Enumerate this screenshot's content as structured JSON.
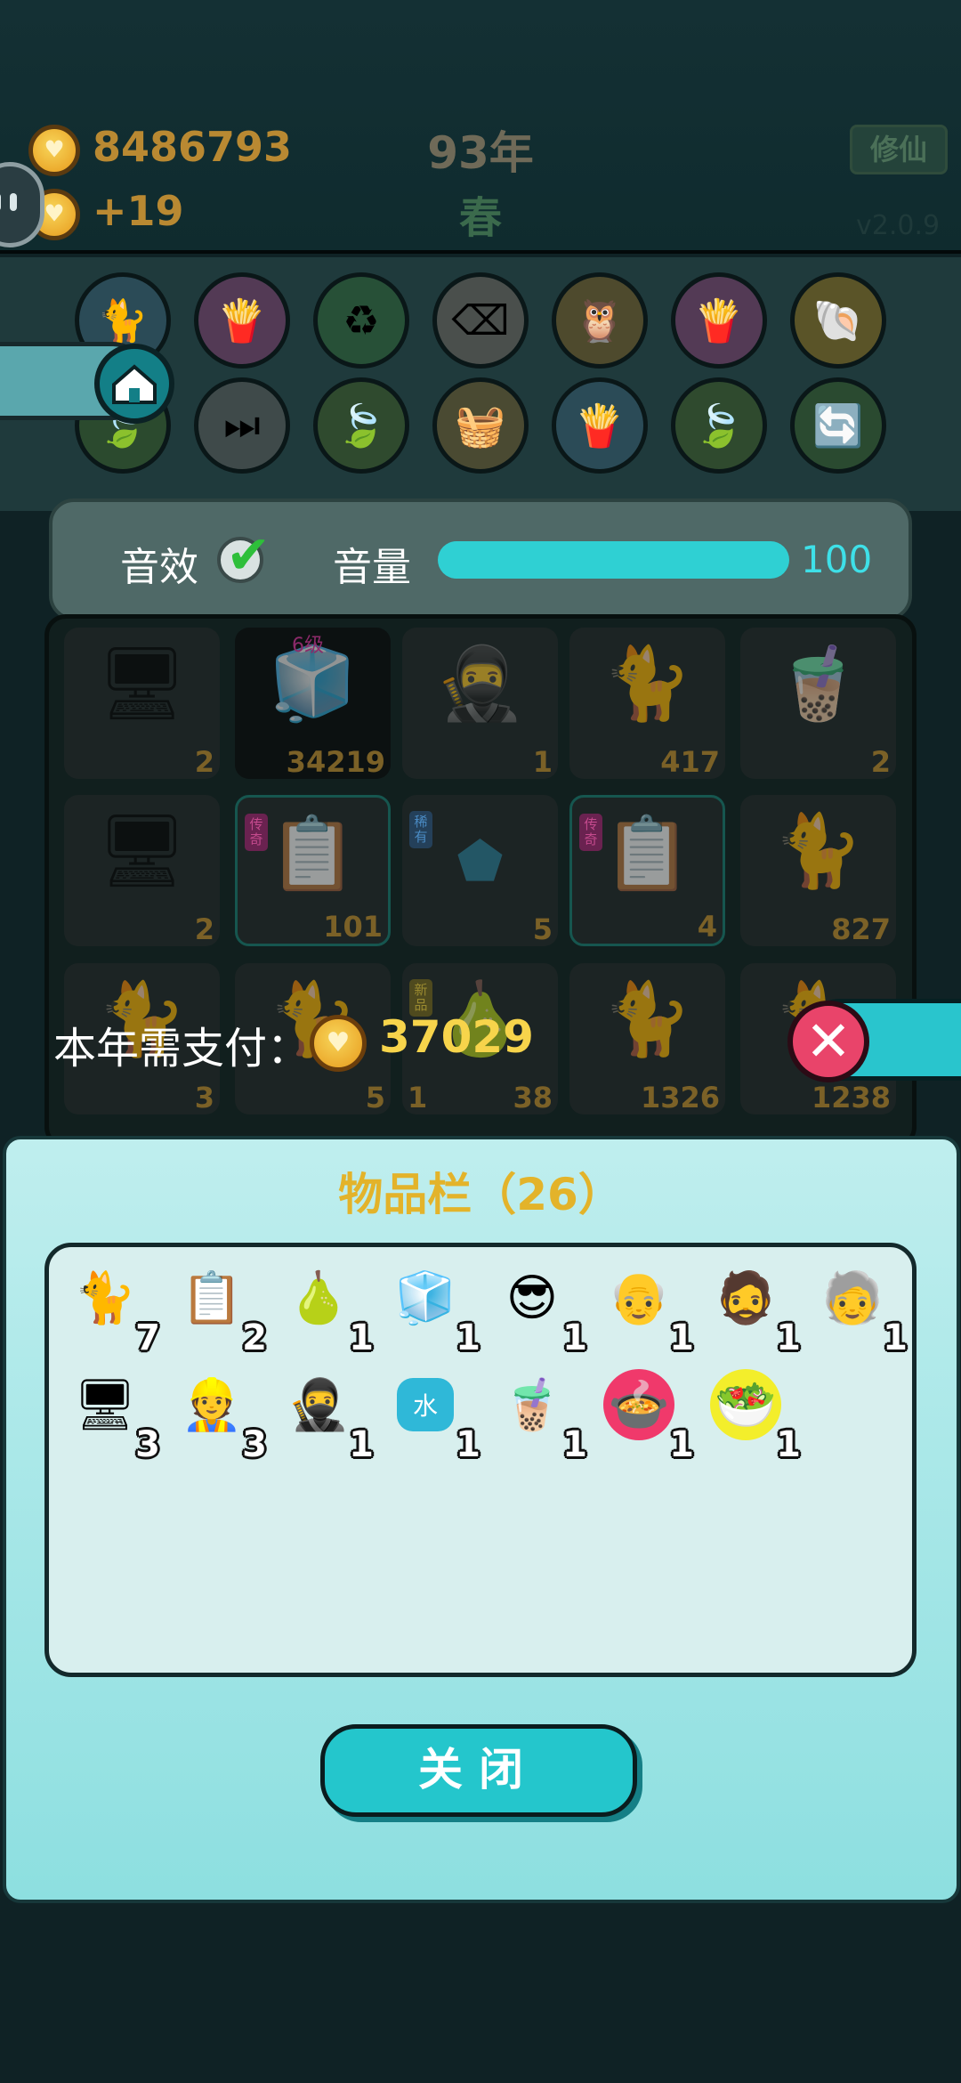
{
  "top": {
    "coins": "8486793",
    "income": "+19",
    "year": "93年",
    "season": "春",
    "cultivate_label": "修仙",
    "version": "v2.0.9"
  },
  "settings": {
    "sound_label": "音效",
    "volume_label": "音量",
    "volume_value": "100",
    "volume_level_percent": 100,
    "sound_enabled": true
  },
  "board": {
    "cell_counts": [
      "2",
      "34219",
      "1",
      "417",
      "2",
      "2",
      "101",
      "5",
      "4",
      "827",
      "3",
      "5",
      "1",
      "38",
      "1326",
      "1238"
    ],
    "badge_level": "6级",
    "tag_legend": "传奇",
    "tag_rare": "稀有",
    "tag_special": "新品"
  },
  "payment": {
    "label": "本年需支付：",
    "amount": "37029"
  },
  "inventory": {
    "title": "物品栏（26）",
    "items": [
      {
        "icon": "cat-icon",
        "glyph": "🐈",
        "count": "7"
      },
      {
        "icon": "copy-paste-card-icon",
        "glyph": "📋",
        "count": "2"
      },
      {
        "icon": "pomelo-icon",
        "glyph": "🍐",
        "count": "1"
      },
      {
        "icon": "fridge-icon",
        "glyph": "🧊",
        "count": "1"
      },
      {
        "icon": "sunglasses-man-icon",
        "glyph": "😎",
        "count": "1"
      },
      {
        "icon": "old-man-glasses-icon",
        "glyph": "👴",
        "count": "1"
      },
      {
        "icon": "bucket-hat-man-icon",
        "glyph": "🧔",
        "count": "1"
      },
      {
        "icon": "bald-man-glasses-icon",
        "glyph": "🧓",
        "count": "1"
      },
      {
        "icon": "monitor-icon",
        "glyph": "🖥",
        "count": "3"
      },
      {
        "icon": "worker-cap-icon",
        "glyph": "👷",
        "count": "3"
      },
      {
        "icon": "thief-icon",
        "glyph": "🥷",
        "count": "1"
      },
      {
        "icon": "water-gem-icon",
        "glyph": "水",
        "count": "1"
      },
      {
        "icon": "bubble-tea-icon",
        "glyph": "🧋",
        "count": "1"
      },
      {
        "icon": "red-bowl-icon",
        "glyph": "🍲",
        "count": "1"
      },
      {
        "icon": "yellow-bowl-icon",
        "glyph": "🥗",
        "count": "1"
      }
    ],
    "close_label": "关闭"
  }
}
